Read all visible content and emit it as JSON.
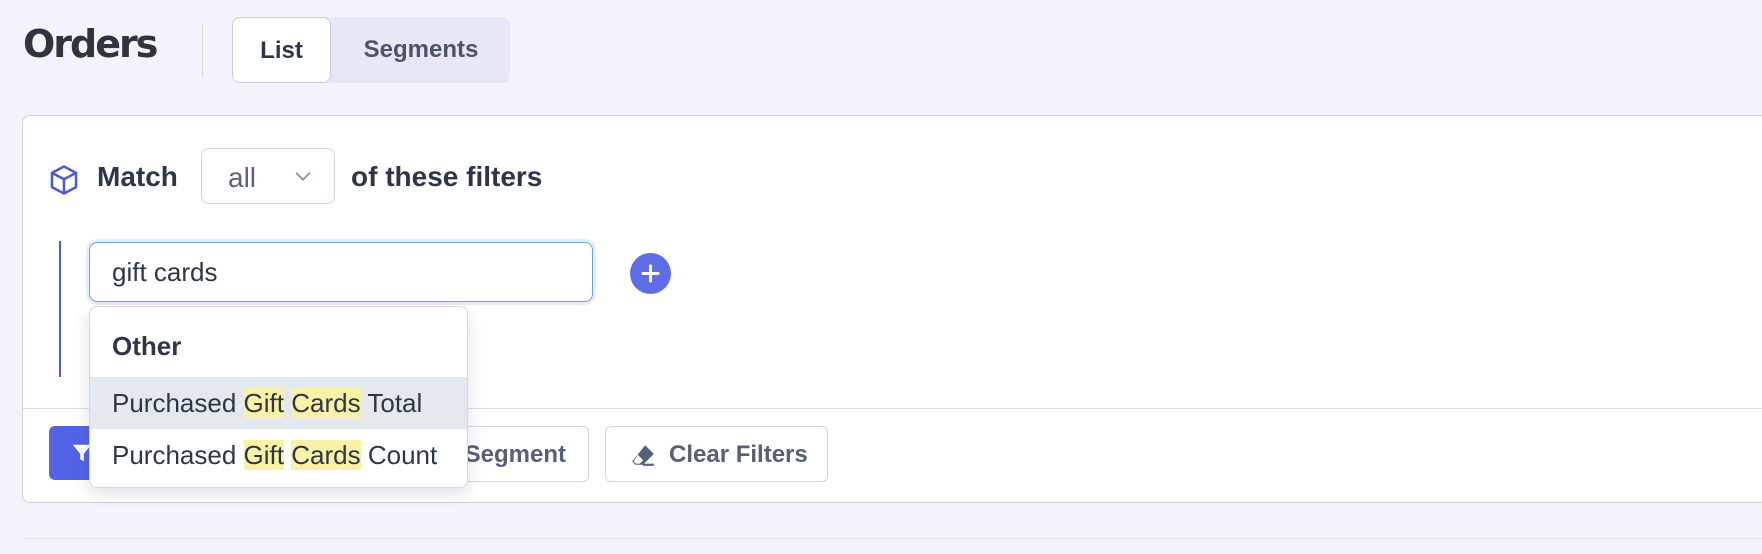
{
  "header": {
    "title": "Orders",
    "tabs": [
      {
        "label": "List",
        "active": true
      },
      {
        "label": "Segments",
        "active": false
      }
    ]
  },
  "filter_panel": {
    "icon": "cube-icon",
    "match_label": "Match",
    "match_select": {
      "value": "all"
    },
    "match_suffix": "of these filters",
    "search": {
      "value": "gift cards"
    },
    "add_icon": "plus-icon"
  },
  "dropdown": {
    "group_label": "Other",
    "items": [
      {
        "prefix": "Purchased",
        "highlight_1": "Gift",
        "highlight_2": "Cards",
        "suffix": "Total",
        "hovered": true
      },
      {
        "prefix": "Purchased",
        "highlight_1": "Gift",
        "highlight_2": "Cards",
        "suffix": "Count",
        "hovered": false
      }
    ]
  },
  "actions": {
    "apply_icon": "filter-icon",
    "save_segment_label": "Segment",
    "clear_filters_label": "Clear Filters",
    "clear_icon": "eraser-icon"
  },
  "colors": {
    "accent": "#5363e6",
    "highlight": "#f8f1a6",
    "background": "#f4f3fc"
  }
}
